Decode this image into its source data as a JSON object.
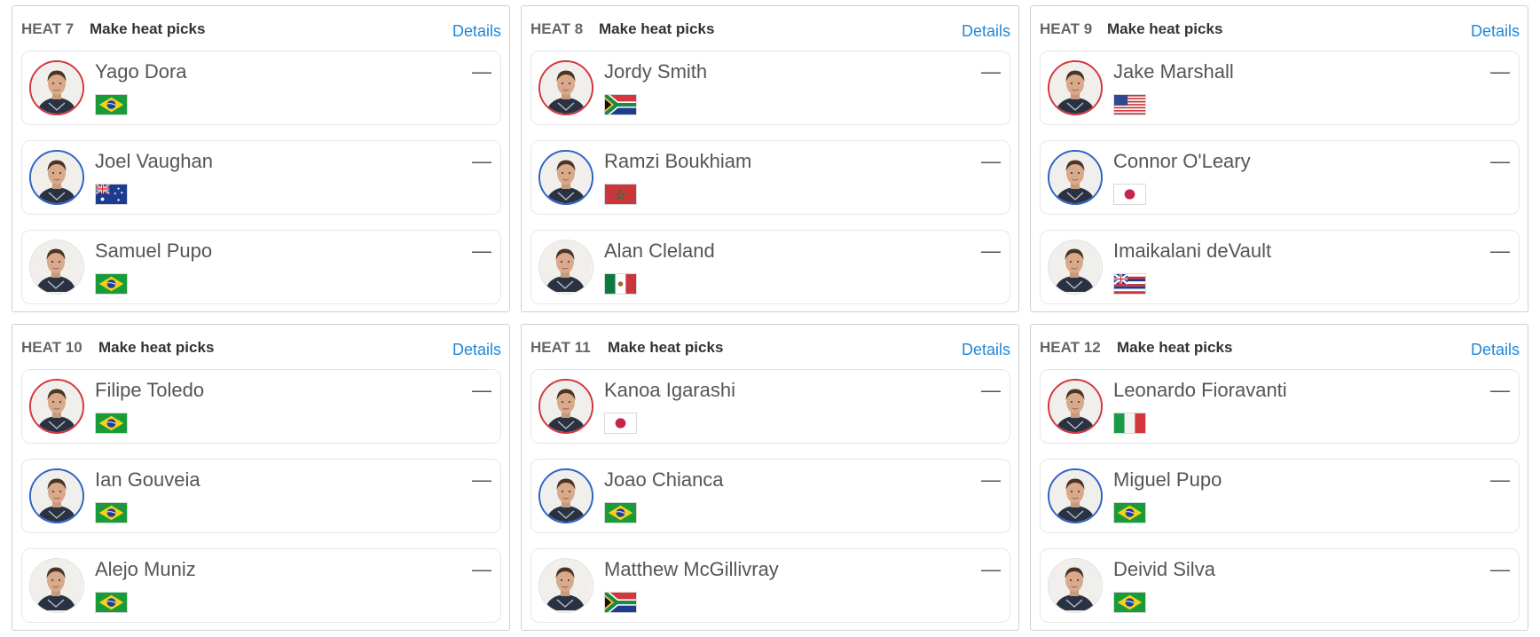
{
  "heats": [
    {
      "label": "HEAT 7",
      "picks_label": "Make heat picks",
      "details_label": "Details",
      "surfers": [
        {
          "name": "Yago Dora",
          "flag": "brazil-flag",
          "jersey": "red",
          "score": "—"
        },
        {
          "name": "Joel Vaughan",
          "flag": "australia-flag",
          "jersey": "blue",
          "score": "—"
        },
        {
          "name": "Samuel Pupo",
          "flag": "brazil-flag",
          "jersey": "white",
          "score": "—"
        }
      ]
    },
    {
      "label": "HEAT 8",
      "picks_label": "Make heat picks",
      "details_label": "Details",
      "surfers": [
        {
          "name": "Jordy Smith",
          "flag": "south-africa-flag",
          "jersey": "red",
          "score": "—"
        },
        {
          "name": "Ramzi Boukhiam",
          "flag": "morocco-flag",
          "jersey": "blue",
          "score": "—"
        },
        {
          "name": "Alan Cleland",
          "flag": "mexico-flag",
          "jersey": "white",
          "score": "—"
        }
      ]
    },
    {
      "label": "HEAT 9",
      "picks_label": "Make heat picks",
      "details_label": "Details",
      "surfers": [
        {
          "name": "Jake Marshall",
          "flag": "usa-flag",
          "jersey": "red",
          "score": "—"
        },
        {
          "name": "Connor O'Leary",
          "flag": "japan-flag",
          "jersey": "blue",
          "score": "—"
        },
        {
          "name": "Imaikalani deVault",
          "flag": "hawaii-flag",
          "jersey": "white",
          "score": "—"
        }
      ]
    },
    {
      "label": "HEAT 10",
      "picks_label": "Make heat picks",
      "details_label": "Details",
      "surfers": [
        {
          "name": "Filipe Toledo",
          "flag": "brazil-flag",
          "jersey": "red",
          "score": "—"
        },
        {
          "name": "Ian Gouveia",
          "flag": "brazil-flag",
          "jersey": "blue",
          "score": "—"
        },
        {
          "name": "Alejo Muniz",
          "flag": "brazil-flag",
          "jersey": "white",
          "score": "—"
        }
      ]
    },
    {
      "label": "HEAT 11",
      "picks_label": "Make heat picks",
      "details_label": "Details",
      "surfers": [
        {
          "name": "Kanoa Igarashi",
          "flag": "japan-flag",
          "jersey": "red",
          "score": "—"
        },
        {
          "name": "Joao Chianca",
          "flag": "brazil-flag",
          "jersey": "blue",
          "score": "—"
        },
        {
          "name": "Matthew McGillivray",
          "flag": "south-africa-flag",
          "jersey": "white",
          "score": "—"
        }
      ]
    },
    {
      "label": "HEAT 12",
      "picks_label": "Make heat picks",
      "details_label": "Details",
      "surfers": [
        {
          "name": "Leonardo Fioravanti",
          "flag": "italy-flag",
          "jersey": "red",
          "score": "—"
        },
        {
          "name": "Miguel Pupo",
          "flag": "brazil-flag",
          "jersey": "blue",
          "score": "—"
        },
        {
          "name": "Deivid Silva",
          "flag": "brazil-flag",
          "jersey": "white",
          "score": "—"
        }
      ]
    }
  ],
  "colors": {
    "link": "#1f87d8",
    "jersey_red": "#d3363c",
    "jersey_blue": "#2d62c6",
    "jersey_white": "#e2e2e2"
  }
}
